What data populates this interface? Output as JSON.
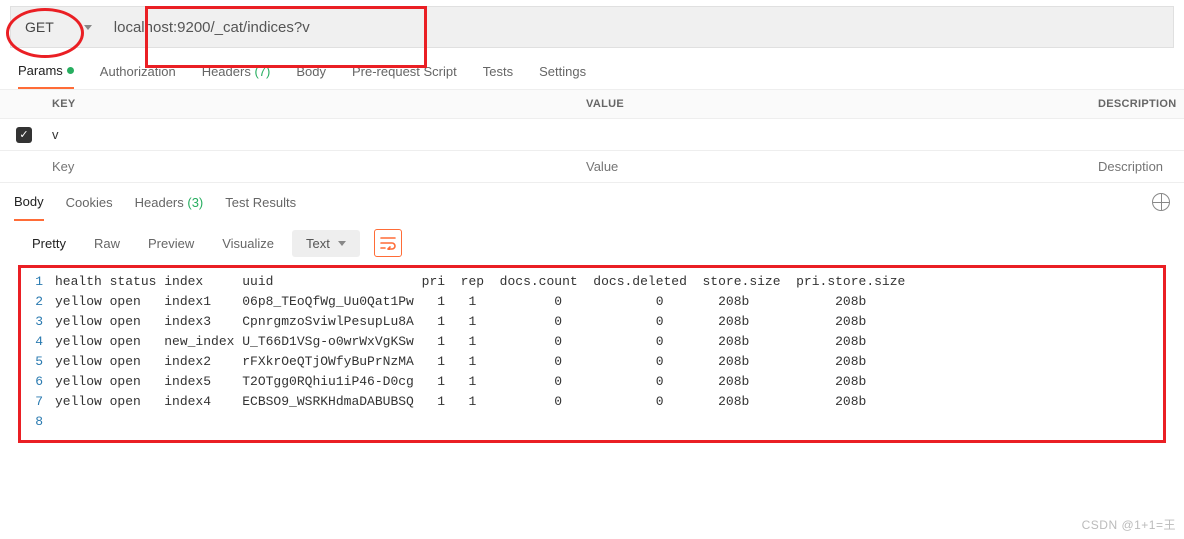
{
  "request": {
    "method": "GET",
    "url": "localhost:9200/_cat/indices?v"
  },
  "request_tabs": {
    "params": "Params",
    "auth": "Authorization",
    "headers_label": "Headers",
    "headers_count": "(7)",
    "body": "Body",
    "prerequest": "Pre-request Script",
    "tests": "Tests",
    "settings": "Settings"
  },
  "param_headers": {
    "key": "KEY",
    "value": "VALUE",
    "desc": "DESCRIPTION"
  },
  "params_rows": [
    {
      "enabled": true,
      "key": "v",
      "value": "",
      "desc": ""
    }
  ],
  "param_placeholders": {
    "key": "Key",
    "value": "Value",
    "desc": "Description"
  },
  "response_tabs": {
    "body": "Body",
    "cookies": "Cookies",
    "headers_label": "Headers",
    "headers_count": "(3)",
    "test_results": "Test Results"
  },
  "view_tabs": {
    "pretty": "Pretty",
    "raw": "Raw",
    "preview": "Preview",
    "visualize": "Visualize",
    "mode": "Text"
  },
  "response_body": {
    "headers": [
      "health",
      "status",
      "index",
      "uuid",
      "pri",
      "rep",
      "docs.count",
      "docs.deleted",
      "store.size",
      "pri.store.size"
    ],
    "rows": [
      {
        "health": "yellow",
        "status": "open",
        "index": "index1",
        "uuid": "06p8_TEoQfWg_Uu0Qat1Pw",
        "pri": 1,
        "rep": 1,
        "docs_count": 0,
        "docs_deleted": 0,
        "store_size": "208b",
        "pri_store_size": "208b"
      },
      {
        "health": "yellow",
        "status": "open",
        "index": "index3",
        "uuid": "CpnrgmzoSviwlPesupLu8A",
        "pri": 1,
        "rep": 1,
        "docs_count": 0,
        "docs_deleted": 0,
        "store_size": "208b",
        "pri_store_size": "208b"
      },
      {
        "health": "yellow",
        "status": "open",
        "index": "new_index",
        "uuid": "U_T66D1VSg-o0wrWxVgKSw",
        "pri": 1,
        "rep": 1,
        "docs_count": 0,
        "docs_deleted": 0,
        "store_size": "208b",
        "pri_store_size": "208b"
      },
      {
        "health": "yellow",
        "status": "open",
        "index": "index2",
        "uuid": "rFXkrOeQTjOWfyBuPrNzMA",
        "pri": 1,
        "rep": 1,
        "docs_count": 0,
        "docs_deleted": 0,
        "store_size": "208b",
        "pri_store_size": "208b"
      },
      {
        "health": "yellow",
        "status": "open",
        "index": "index5",
        "uuid": "T2OTgg0RQhiu1iP46-D0cg",
        "pri": 1,
        "rep": 1,
        "docs_count": 0,
        "docs_deleted": 0,
        "store_size": "208b",
        "pri_store_size": "208b"
      },
      {
        "health": "yellow",
        "status": "open",
        "index": "index4",
        "uuid": "ECBSO9_WSRKHdmaDABUBSQ",
        "pri": 1,
        "rep": 1,
        "docs_count": 0,
        "docs_deleted": 0,
        "store_size": "208b",
        "pri_store_size": "208b"
      }
    ]
  },
  "watermark": "CSDN @1+1=王"
}
